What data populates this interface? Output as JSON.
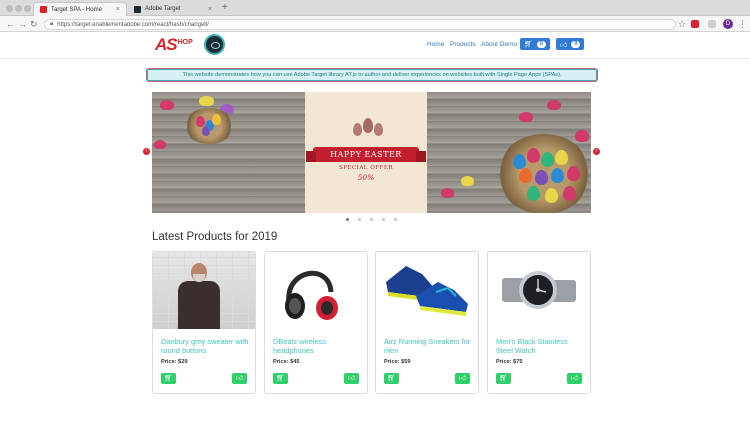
{
  "browser": {
    "tabs": [
      {
        "title": "Target SPA - Home",
        "active": true
      },
      {
        "title": "Adobe Target",
        "active": false
      }
    ],
    "url": "https://target.enablementadobe.com/react/hash/changelt/",
    "profile_initial": "D"
  },
  "site": {
    "logo_text": "AS",
    "logo_suffix": "HOP",
    "nav": [
      "Home",
      "Products",
      "About Demo"
    ],
    "cart_count": "0",
    "like_count": "0"
  },
  "banner": {
    "text": "This website demonstrates how you can use Adobe Target library AT.js to author and deliver experiences on websites built with Single Page Apps (SPAs)."
  },
  "carousel": {
    "headline": "HAPPY EASTER",
    "subline": "SPECIAL OFFER",
    "discount": "50%",
    "slide_count": 5,
    "active_slide": 0,
    "colors": {
      "ribbon": "#c41f2e",
      "arrow": "#d9232e"
    }
  },
  "products": {
    "section_title": "Latest Products for 2019",
    "price_label": "Price:",
    "items": [
      {
        "name": "Danbury grey sweater with round buttons",
        "price": "$29"
      },
      {
        "name": "DBeatz wireless headphones",
        "price": "$45"
      },
      {
        "name": "Airz Running Sneakers for men",
        "price": "$59"
      },
      {
        "name": "Men's Black Stainless Steel Watch",
        "price": "$75"
      }
    ],
    "colors": {
      "name": "#41c8b8",
      "button": "#2fcf6c"
    }
  }
}
